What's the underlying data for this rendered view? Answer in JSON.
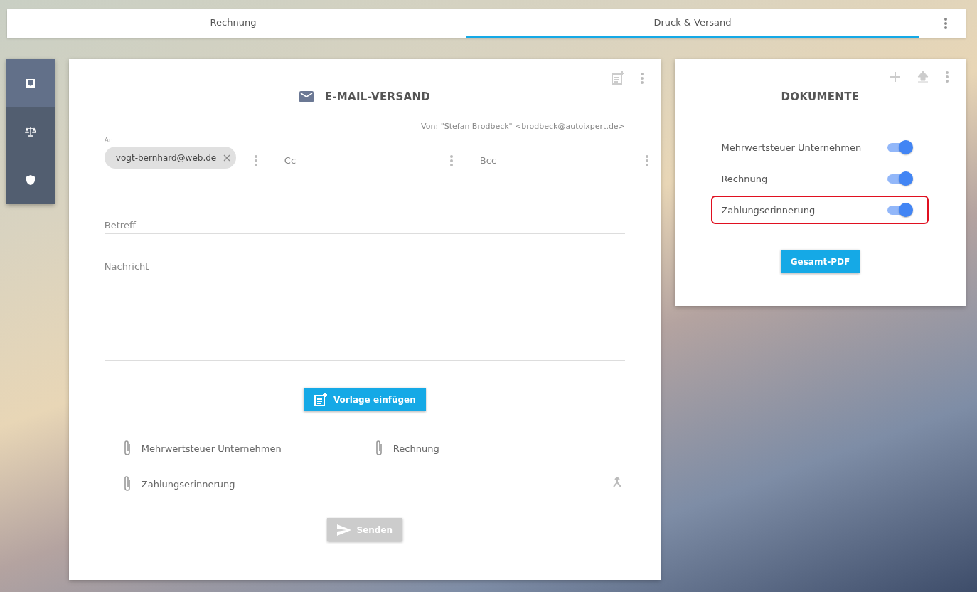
{
  "tabs": [
    {
      "label": "Rechnung",
      "selected": false
    },
    {
      "label": "Druck & Versand",
      "selected": true
    }
  ],
  "sidebar": {
    "items": [
      {
        "kind": "inbox",
        "selected": true
      },
      {
        "kind": "scale",
        "selected": false
      },
      {
        "kind": "shield",
        "selected": false
      }
    ]
  },
  "email": {
    "title": "E-MAIL-VERSAND",
    "from": "Von: \"Stefan Brodbeck\" <brodbeck@autoixpert.de>",
    "to": {
      "label": "An",
      "recipients": [
        "vogt-bernhard@web.de"
      ]
    },
    "cc": {
      "placeholder": "Cc"
    },
    "bcc": {
      "placeholder": "Bcc"
    },
    "subject": {
      "placeholder": "Betreff"
    },
    "message": {
      "placeholder": "Nachricht"
    },
    "template_button": "Vorlage einfügen",
    "attachments": [
      "Mehrwertsteuer Unternehmen",
      "Rechnung",
      "Zahlungserinnerung"
    ],
    "send_button": {
      "label": "Senden",
      "disabled": true
    }
  },
  "documents": {
    "title": "DOKUMENTE",
    "items": [
      {
        "name": "Mehrwertsteuer Unternehmen",
        "on": true,
        "highlighted": false
      },
      {
        "name": "Rechnung",
        "on": true,
        "highlighted": false
      },
      {
        "name": "Zahlungserinnerung",
        "on": true,
        "highlighted": true
      }
    ],
    "button": "Gesamt-PDF"
  }
}
